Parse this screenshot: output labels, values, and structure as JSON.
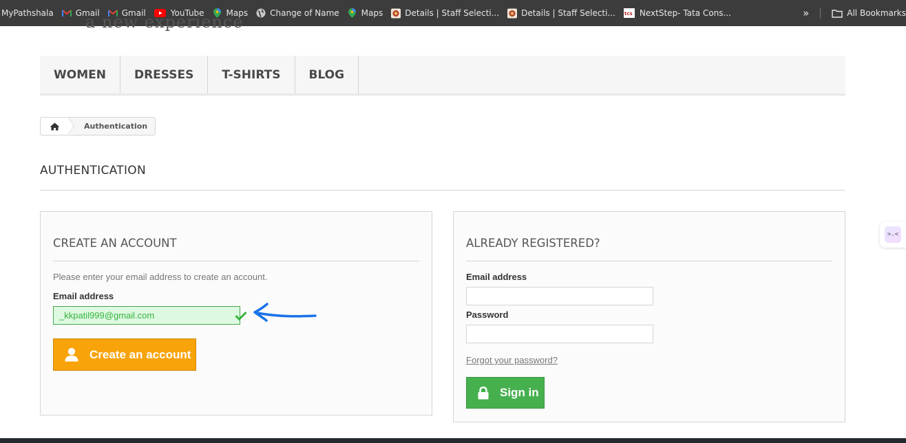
{
  "bookmarks_bar": {
    "items": [
      {
        "label": "MyPathshala",
        "icon": "none"
      },
      {
        "label": "Gmail",
        "icon": "gmail-icon"
      },
      {
        "label": "Gmail",
        "icon": "gmail-icon"
      },
      {
        "label": "YouTube",
        "icon": "youtube-icon"
      },
      {
        "label": "Maps",
        "icon": "maps-pin-icon"
      },
      {
        "label": "Change of Name",
        "icon": "globe-icon"
      },
      {
        "label": "Maps",
        "icon": "maps-pin-icon"
      },
      {
        "label": "Details | Staff Selecti...",
        "icon": "emblem-icon"
      },
      {
        "label": "Details | Staff Selecti...",
        "icon": "emblem-icon"
      },
      {
        "label": "NextStep- Tata Cons...",
        "icon": "tcs-icon"
      }
    ],
    "more_label": "»",
    "all_bookmarks_label": "All Bookmarks"
  },
  "header": {
    "tagline": "a new experience"
  },
  "menu": {
    "items": [
      "WOMEN",
      "DRESSES",
      "T-SHIRTS",
      "BLOG"
    ]
  },
  "breadcrumb": {
    "home_icon": "home-icon",
    "current": "Authentication"
  },
  "page": {
    "heading": "AUTHENTICATION"
  },
  "create_account": {
    "title": "CREATE AN ACCOUNT",
    "hint": "Please enter your email address to create an account.",
    "email_label": "Email address",
    "email_value": "_kkpatil999@gmail.com",
    "button_label": "Create an account"
  },
  "login": {
    "title": "ALREADY REGISTERED?",
    "email_label": "Email address",
    "email_value": "",
    "password_label": "Password",
    "password_value": "",
    "forgot_label": "Forgot your password?",
    "button_label": "Sign in"
  },
  "colors": {
    "orange_button": "#f9a30a",
    "green_button": "#46b04e",
    "valid_field_bg": "#ddf9e1",
    "annotation_arrow": "#1a73e8"
  }
}
